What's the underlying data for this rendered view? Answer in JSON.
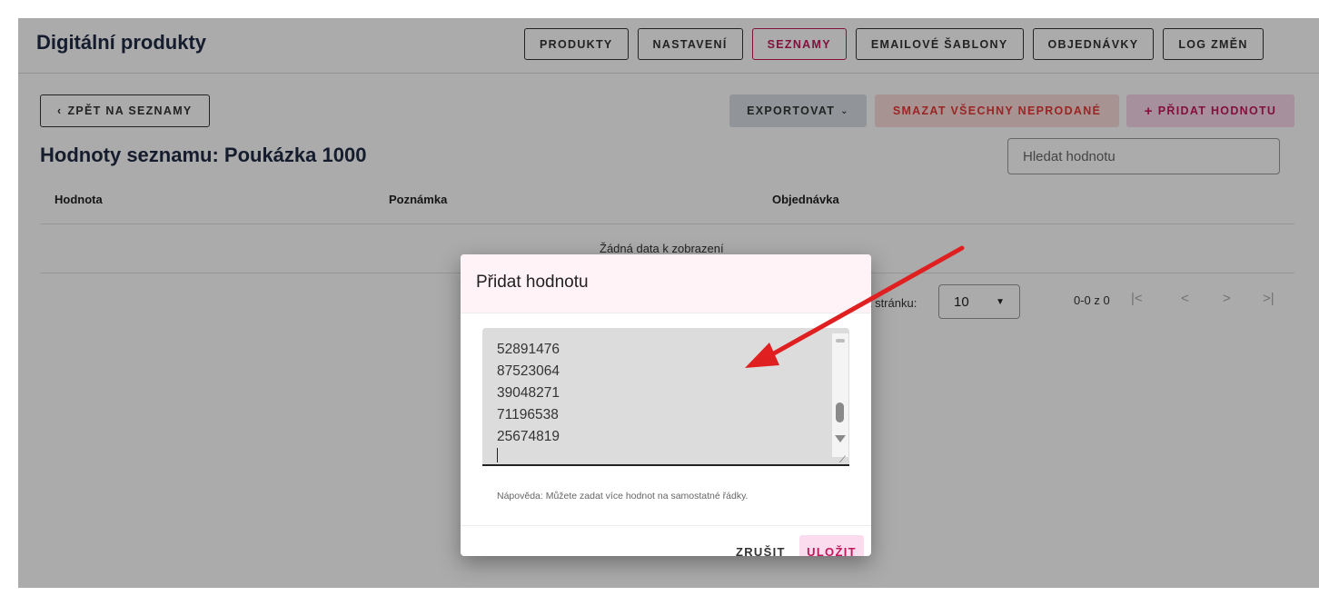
{
  "header": {
    "title": "Digitální produkty",
    "nav": [
      {
        "label": "PRODUKTY",
        "active": false
      },
      {
        "label": "NASTAVENÍ",
        "active": false
      },
      {
        "label": "SEZNAMY",
        "active": true
      },
      {
        "label": "EMAILOVÉ ŠABLONY",
        "active": false
      },
      {
        "label": "OBJEDNÁVKY",
        "active": false
      },
      {
        "label": "LOG ZMĚN",
        "active": false
      }
    ]
  },
  "toolbar": {
    "back_label": "ZPĚT NA SEZNAMY",
    "back_icon": "chevron-left-icon",
    "export_label": "EXPORTOVAT",
    "export_icon": "chevron-down-icon",
    "delete_label": "SMAZAT VŠECHNY NEPRODANÉ",
    "add_label": "PŘIDAT HODNOTU",
    "add_icon": "plus-icon"
  },
  "list": {
    "title": "Hodnoty seznamu: Poukázka 1000",
    "search_placeholder": "Hledat hodnotu",
    "columns": [
      "Hodnota",
      "Poznámka",
      "Objednávka"
    ],
    "empty_text": "Žádná data k zobrazení"
  },
  "pager": {
    "per_page_label": "na stránku:",
    "per_page_value": "10",
    "range": "0-0 z 0",
    "first": "|<",
    "prev": "<",
    "next": ">",
    "last": ">|"
  },
  "dialog": {
    "title": "Přidat hodnotu",
    "values": [
      "52891476",
      "87523064",
      "39048271",
      "71196538",
      "25674819"
    ],
    "hint": "Nápověda: Můžete zadat více hodnot na samostatné řádky.",
    "cancel_label": "ZRUŠIT",
    "save_label": "ULOŽIT"
  },
  "colors": {
    "accent": "#c2185b",
    "danger": "#e53935",
    "annotation_arrow": "#e02020"
  }
}
